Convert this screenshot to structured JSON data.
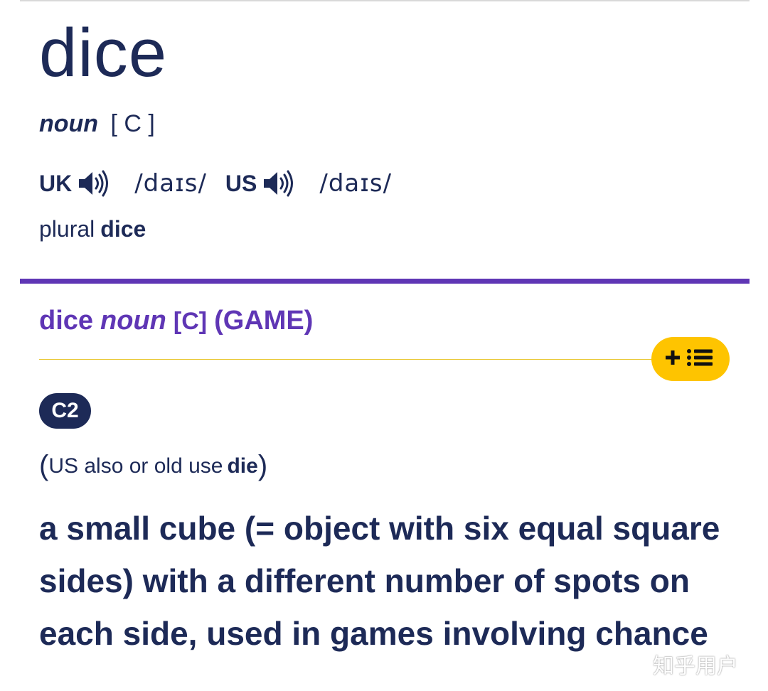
{
  "entry": {
    "headword": "dice",
    "part_of_speech": "noun",
    "grammar_code": "[ C ]",
    "pronunciations": [
      {
        "region": "UK",
        "ipa": "/daɪs/",
        "icon": "speaker-icon"
      },
      {
        "region": "US",
        "ipa": "/daɪs/",
        "icon": "speaker-icon"
      }
    ],
    "plural_label": "plural",
    "plural_form": "dice"
  },
  "sense": {
    "headword": "dice",
    "part_of_speech": "noun",
    "grammar_code": "[C]",
    "guide_word": "(GAME)",
    "add_to_list_icon": "add-to-word-list-icon",
    "level": "C2",
    "usage_open": "(",
    "usage_label": "US also or old use",
    "usage_variant": "die",
    "usage_close": ")",
    "definition": "a small cube (= object with six equal square sides) with a different number of spots on each side, used in games involving chance"
  },
  "watermark": "知乎用户",
  "colors": {
    "text_navy": "#1d2a57",
    "accent_purple": "#5f36b5",
    "button_yellow": "#fec400",
    "badge_navy": "#1d2a57"
  }
}
